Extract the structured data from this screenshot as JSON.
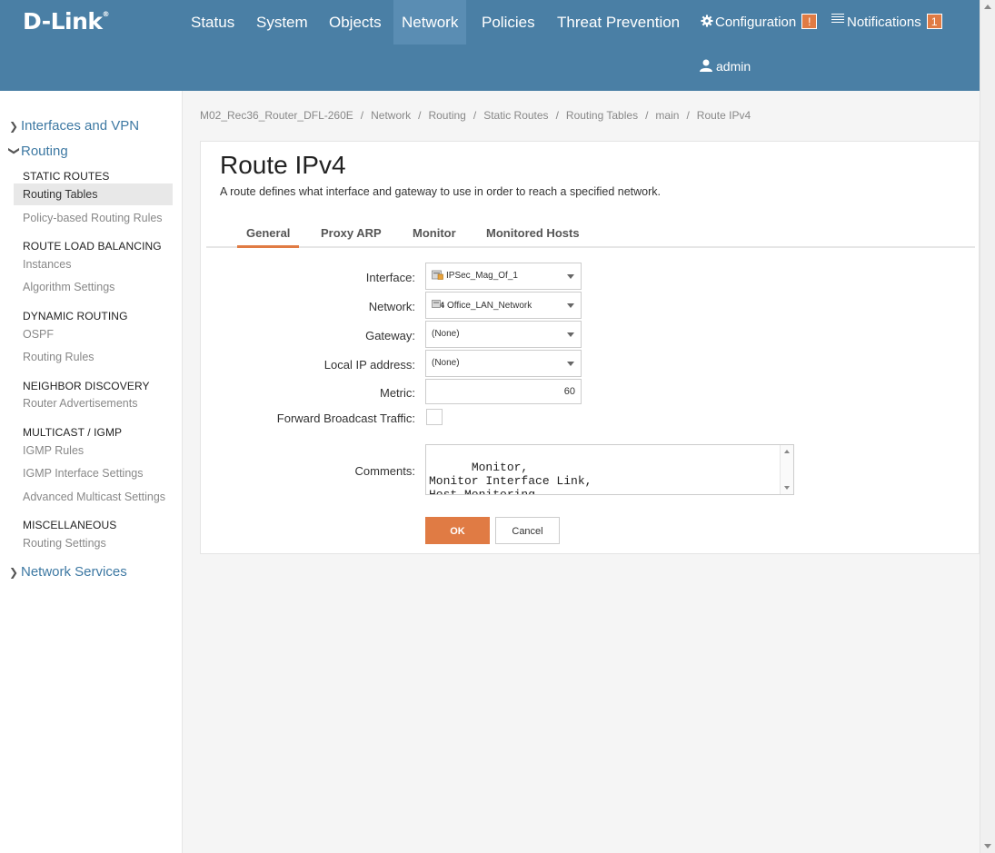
{
  "brand": {
    "name": "D-Link",
    "mark": "®"
  },
  "topnav": {
    "items": [
      {
        "label": "Status"
      },
      {
        "label": "System"
      },
      {
        "label": "Objects"
      },
      {
        "label": "Network"
      },
      {
        "label": "Policies"
      },
      {
        "label": "Threat Prevention"
      }
    ],
    "configuration": {
      "label": "Configuration",
      "badge": "!"
    },
    "notifications": {
      "label": "Notifications",
      "badge": "1"
    },
    "user": "admin"
  },
  "sidebar": {
    "interfaces_vpn": "Interfaces and VPN",
    "routing": "Routing",
    "network_services": "Network Services",
    "groups": {
      "static_routes": {
        "heading": "STATIC ROUTES",
        "items": [
          "Routing Tables",
          "Policy-based Routing Rules"
        ]
      },
      "route_load_balancing": {
        "heading": "ROUTE LOAD BALANCING",
        "items": [
          "Instances",
          "Algorithm Settings"
        ]
      },
      "dynamic_routing": {
        "heading": "DYNAMIC ROUTING",
        "items": [
          "OSPF",
          "Routing Rules"
        ]
      },
      "neighbor_discovery": {
        "heading": "NEIGHBOR DISCOVERY",
        "items": [
          "Router Advertisements"
        ]
      },
      "multicast": {
        "heading": "MULTICAST / IGMP",
        "items": [
          "IGMP Rules",
          "IGMP Interface Settings",
          "Advanced Multicast Settings"
        ]
      },
      "misc": {
        "heading": "MISCELLANEOUS",
        "items": [
          "Routing Settings"
        ]
      }
    }
  },
  "breadcrumb": [
    "M02_Rec36_Router_DFL-260E",
    "Network",
    "Routing",
    "Static Routes",
    "Routing Tables",
    "main",
    "Route IPv4"
  ],
  "page": {
    "title": "Route IPv4",
    "description": "A route defines what interface and gateway to use in order to reach a specified network."
  },
  "tabs": [
    "General",
    "Proxy ARP",
    "Monitor",
    "Monitored Hosts"
  ],
  "form": {
    "interface": {
      "label": "Interface:",
      "value": "IPSec_Mag_Of_1"
    },
    "network": {
      "label": "Network:",
      "value": "Office_LAN_Network",
      "icon_digit": "4"
    },
    "gateway": {
      "label": "Gateway:",
      "value": "(None)"
    },
    "local_ip": {
      "label": "Local IP address:",
      "value": "(None)"
    },
    "metric": {
      "label": "Metric:",
      "value": "60"
    },
    "forward_broadcast": {
      "label": "Forward Broadcast Traffic:",
      "checked": false
    },
    "comments": {
      "label": "Comments:",
      "value": "Monitor,\nMonitor Interface Link,\nHost Monitoring."
    },
    "ok": "OK",
    "cancel": "Cancel"
  },
  "colors": {
    "header": "#4a7fa5",
    "accent": "#e07b44",
    "link": "#3e79a3"
  }
}
